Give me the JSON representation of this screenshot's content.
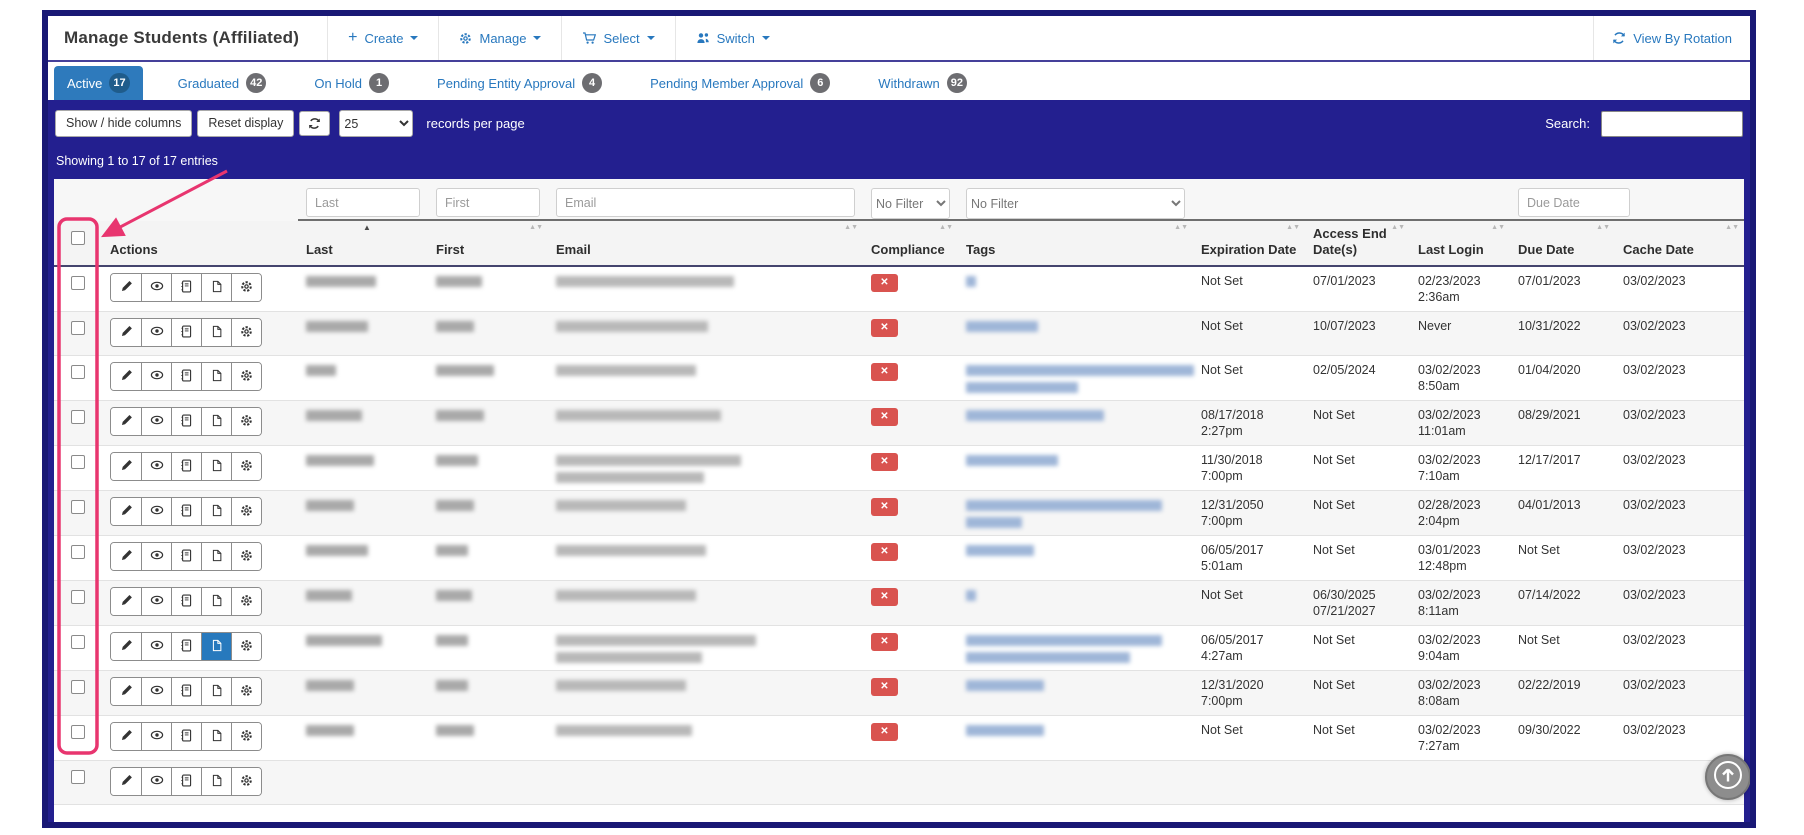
{
  "window": {
    "title": "Manage Students (Affiliated)"
  },
  "menu": {
    "items": [
      {
        "label": "Create",
        "icon": "plus-icon"
      },
      {
        "label": "Manage",
        "icon": "gear-icon"
      },
      {
        "label": "Select",
        "icon": "cart-icon"
      },
      {
        "label": "Switch",
        "icon": "users-icon"
      }
    ],
    "view_by_rotation": "View By Rotation"
  },
  "tabs": [
    {
      "label": "Active",
      "count": "17",
      "active": true
    },
    {
      "label": "Graduated",
      "count": "42",
      "active": false
    },
    {
      "label": "On Hold",
      "count": "1",
      "active": false
    },
    {
      "label": "Pending Entity Approval",
      "count": "4",
      "active": false
    },
    {
      "label": "Pending Member Approval",
      "count": "6",
      "active": false
    },
    {
      "label": "Withdrawn",
      "count": "92",
      "active": false
    }
  ],
  "toolbar": {
    "show_hide_label": "Show / hide columns",
    "reset_label": "Reset display",
    "page_size": "25",
    "records_label": "records per page",
    "search_label": "Search:",
    "search_value": ""
  },
  "summary": "Showing 1 to 17 of 17 entries",
  "filters": {
    "last_placeholder": "Last",
    "first_placeholder": "First",
    "email_placeholder": "Email",
    "compliance_value": "No Filter",
    "tags_value": "No Filter",
    "due_date_placeholder": "Due Date"
  },
  "table": {
    "columns": [
      "Actions",
      "Last",
      "First",
      "Email",
      "Compliance",
      "Tags",
      "Expiration Date",
      "Access End Date(s)",
      "Last Login",
      "Due Date",
      "Cache Date"
    ],
    "action_icons": [
      "edit",
      "view",
      "book",
      "file",
      "gear"
    ],
    "rows": [
      {
        "last_w": 70,
        "first_w": 46,
        "email_lines": [
          178
        ],
        "tags_lines": [
          10
        ],
        "expiration": [
          "Not Set"
        ],
        "access_end": [
          "07/01/2023"
        ],
        "last_login": [
          "02/23/2023",
          "2:36am"
        ],
        "due_date": "07/01/2023",
        "cache_date": "03/02/2023",
        "active_action": null
      },
      {
        "last_w": 62,
        "first_w": 38,
        "email_lines": [
          152
        ],
        "tags_lines": [
          72
        ],
        "expiration": [
          "Not Set"
        ],
        "access_end": [
          "10/07/2023"
        ],
        "last_login": [
          "Never"
        ],
        "due_date": "10/31/2022",
        "cache_date": "03/02/2023",
        "active_action": null
      },
      {
        "last_w": 30,
        "first_w": 58,
        "email_lines": [
          140
        ],
        "tags_lines": [
          228,
          112
        ],
        "expiration": [
          "Not Set"
        ],
        "access_end": [
          "02/05/2024"
        ],
        "last_login": [
          "03/02/2023",
          "8:50am"
        ],
        "due_date": "01/04/2020",
        "cache_date": "03/02/2023",
        "active_action": null
      },
      {
        "last_w": 56,
        "first_w": 48,
        "email_lines": [
          165
        ],
        "tags_lines": [
          138
        ],
        "expiration": [
          "08/17/2018",
          "2:27pm"
        ],
        "access_end": [
          "Not Set"
        ],
        "last_login": [
          "03/02/2023",
          "11:01am"
        ],
        "due_date": "08/29/2021",
        "cache_date": "03/02/2023",
        "active_action": null
      },
      {
        "last_w": 68,
        "first_w": 42,
        "email_lines": [
          185,
          148
        ],
        "tags_lines": [
          92
        ],
        "expiration": [
          "11/30/2018",
          "7:00pm"
        ],
        "access_end": [
          "Not Set"
        ],
        "last_login": [
          "03/02/2023",
          "7:10am"
        ],
        "due_date": "12/17/2017",
        "cache_date": "03/02/2023",
        "active_action": null
      },
      {
        "last_w": 48,
        "first_w": 38,
        "email_lines": [
          130
        ],
        "tags_lines": [
          196,
          56
        ],
        "expiration": [
          "12/31/2050",
          "7:00pm"
        ],
        "access_end": [
          "Not Set"
        ],
        "last_login": [
          "02/28/2023",
          "2:04pm"
        ],
        "due_date": "04/01/2013",
        "cache_date": "03/02/2023",
        "active_action": null
      },
      {
        "last_w": 62,
        "first_w": 32,
        "email_lines": [
          150
        ],
        "tags_lines": [
          68
        ],
        "expiration": [
          "06/05/2017",
          "5:01am"
        ],
        "access_end": [
          "Not Set"
        ],
        "last_login": [
          "03/01/2023",
          "12:48pm"
        ],
        "due_date": "Not Set",
        "cache_date": "03/02/2023",
        "active_action": null
      },
      {
        "last_w": 46,
        "first_w": 36,
        "email_lines": [
          140
        ],
        "tags_lines": [
          10
        ],
        "expiration": [
          "Not Set"
        ],
        "access_end": [
          "06/30/2025",
          "07/21/2027"
        ],
        "last_login": [
          "03/02/2023",
          "8:11am"
        ],
        "due_date": "07/14/2022",
        "cache_date": "03/02/2023",
        "active_action": null
      },
      {
        "last_w": 76,
        "first_w": 32,
        "email_lines": [
          200,
          146
        ],
        "tags_lines": [
          196,
          164
        ],
        "expiration": [
          "06/05/2017",
          "4:27am"
        ],
        "access_end": [
          "Not Set"
        ],
        "last_login": [
          "03/02/2023",
          "9:04am"
        ],
        "due_date": "Not Set",
        "cache_date": "03/02/2023",
        "active_action": 3
      },
      {
        "last_w": 48,
        "first_w": 32,
        "email_lines": [
          130
        ],
        "tags_lines": [
          78
        ],
        "expiration": [
          "12/31/2020",
          "7:00pm"
        ],
        "access_end": [
          "Not Set"
        ],
        "last_login": [
          "03/02/2023",
          "8:08am"
        ],
        "due_date": "02/22/2019",
        "cache_date": "03/02/2023",
        "active_action": null
      },
      {
        "last_w": 48,
        "first_w": 38,
        "email_lines": [
          136
        ],
        "tags_lines": [
          78
        ],
        "expiration": [
          "Not Set"
        ],
        "access_end": [
          "Not Set"
        ],
        "last_login": [
          "03/02/2023",
          "7:27am"
        ],
        "due_date": "09/30/2022",
        "cache_date": "03/02/2023",
        "active_action": null
      },
      {
        "partial": true
      }
    ],
    "compliance_badge": "✕"
  },
  "colors": {
    "navy": "#231f8f",
    "frame": "#191875",
    "tab_active": "#2e7abc",
    "link": "#2878be",
    "badge_gray": "#6d6d71",
    "badge_active": "#1f5c8b",
    "danger": "#d9534f",
    "action_active": "#2779bd",
    "annotation_pink": "#e8356f"
  }
}
